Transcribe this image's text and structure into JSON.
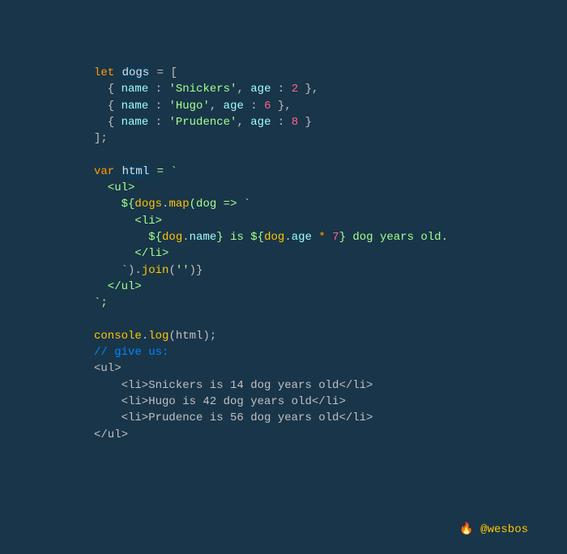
{
  "code": {
    "l1": {
      "let": "let",
      "var": "dogs",
      "eq": " = ["
    },
    "l2": {
      "open": "  { ",
      "k1": "name",
      "sep1": " : ",
      "v1": "'Snickers'",
      "c": ", ",
      "k2": "age",
      "sep2": " : ",
      "v2": "2",
      "close": " },"
    },
    "l3": {
      "open": "  { ",
      "k1": "name",
      "sep1": " : ",
      "v1": "'Hugo'",
      "c": ", ",
      "k2": "age",
      "sep2": " : ",
      "v2": "6",
      "close": " },"
    },
    "l4": {
      "open": "  { ",
      "k1": "name",
      "sep1": " : ",
      "v1": "'Prudence'",
      "c": ", ",
      "k2": "age",
      "sep2": " : ",
      "v2": "8",
      "close": " }"
    },
    "l5": "];",
    "l6": {
      "var": "var",
      "name": "html",
      "eq": " = `"
    },
    "l7_tag": "ul",
    "l8": {
      "open": "${",
      "obj": "dogs",
      "dot": ".",
      "m": "map",
      "args": "(dog => `"
    },
    "l9_tag": "li",
    "l10": {
      "o1": "${",
      "o": "dog",
      "d1": ".",
      "p1": "name",
      "c1": "}",
      "t": " is ",
      "o2": "${",
      "o2o": "dog",
      "d2": ".",
      "p2": "age",
      "mul": " * ",
      "n": "7",
      "c2": "}",
      "tail": " dog years old."
    },
    "l11_tag": "li",
    "l12": {
      "t1": "`).",
      "m": "join",
      "t2": "(",
      "s": "''",
      "t3": ")}"
    },
    "l13_tag": "ul",
    "l14": "`;",
    "l15": {
      "c": "console",
      "dot": ".",
      "m": "log",
      "args": "(html);"
    },
    "l16": "// give us:",
    "out": {
      "o1": "<ul>",
      "o2": "    <li>Snickers is 14 dog years old</li>",
      "o3": "    <li>Hugo is 42 dog years old</li>",
      "o4": "    <li>Prudence is 56 dog years old</li>",
      "o5": "</ul>"
    }
  },
  "sig": {
    "fire": "🔥",
    "handle": " @wesbos"
  }
}
